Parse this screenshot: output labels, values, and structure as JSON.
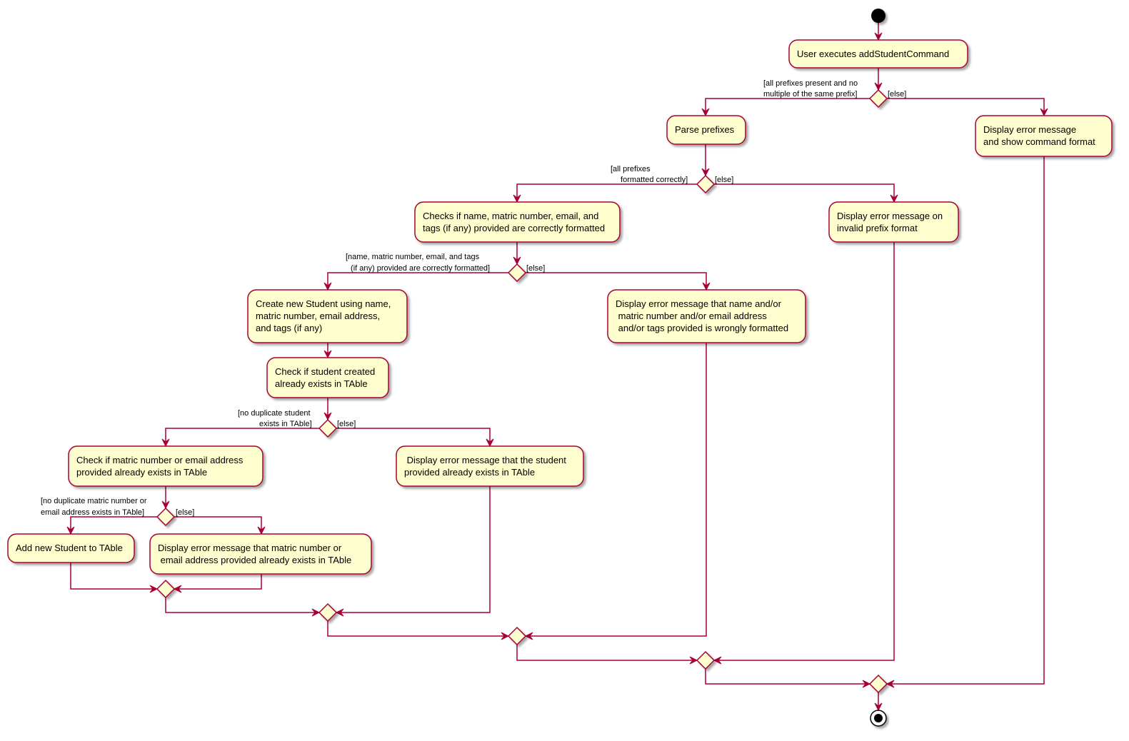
{
  "colors": {
    "stroke": "#A80036",
    "fill": "#FEFECE",
    "start_end": "#000000",
    "shadow": "#c8c8c8"
  },
  "nodes": {
    "start": {
      "type": "start"
    },
    "a1": {
      "type": "activity",
      "lines": [
        "User executes addStudentCommand"
      ]
    },
    "d1": {
      "type": "decision"
    },
    "a2": {
      "type": "activity",
      "lines": [
        "Parse prefixes"
      ]
    },
    "a3": {
      "type": "activity",
      "lines": [
        "Display error message",
        "and show command format"
      ]
    },
    "d2": {
      "type": "decision"
    },
    "a4": {
      "type": "activity",
      "lines": [
        "Checks if name, matric number, email, and",
        "tags (if any) provided are correctly formatted"
      ]
    },
    "a5": {
      "type": "activity",
      "lines": [
        "Display error message on",
        "invalid prefix format"
      ]
    },
    "d3": {
      "type": "decision"
    },
    "a6": {
      "type": "activity",
      "lines": [
        "Create new Student using name,",
        "matric number, email address,",
        "and tags (if any)"
      ]
    },
    "a7": {
      "type": "activity",
      "lines": [
        "Display error message that name and/or",
        " matric number and/or email address",
        " and/or tags provided is wrongly formatted"
      ]
    },
    "a8": {
      "type": "activity",
      "lines": [
        "Check if student created",
        "already exists in TAble"
      ]
    },
    "d4": {
      "type": "decision"
    },
    "a9": {
      "type": "activity",
      "lines": [
        "Check if matric number or email address",
        "provided already exists in TAble"
      ]
    },
    "a10": {
      "type": "activity",
      "lines": [
        " Display error message that the student",
        "provided already exists in TAble"
      ]
    },
    "d5": {
      "type": "decision"
    },
    "a11": {
      "type": "activity",
      "lines": [
        "Add new Student to TAble"
      ]
    },
    "a12": {
      "type": "activity",
      "lines": [
        "Display error message that matric number or",
        " email address provided already exists in TAble"
      ]
    },
    "m1": {
      "type": "merge"
    },
    "m2": {
      "type": "merge"
    },
    "m3": {
      "type": "merge"
    },
    "m4": {
      "type": "merge"
    },
    "m5": {
      "type": "merge"
    },
    "end": {
      "type": "end"
    }
  },
  "guards": {
    "d1_yes": [
      "[all prefixes present and no",
      "multiple of the same prefix]"
    ],
    "d1_no": [
      "[else]"
    ],
    "d2_yes": [
      "[all prefixes",
      " formatted correctly]"
    ],
    "d2_no": [
      "[else]"
    ],
    "d3_yes": [
      "[name, matric number, email, and tags",
      " (if any) provided are correctly formatted]"
    ],
    "d3_no": [
      "[else]"
    ],
    "d4_yes": [
      "[no duplicate student",
      " exists in TAble]"
    ],
    "d4_no": [
      "[else]"
    ],
    "d5_yes": [
      "[no duplicate matric number or",
      "email address exists in TAble]"
    ],
    "d5_no": [
      "[else]"
    ]
  }
}
